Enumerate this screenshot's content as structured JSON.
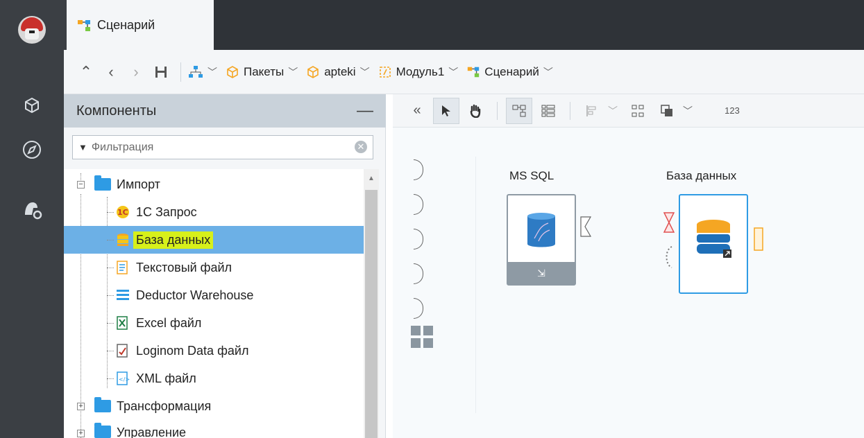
{
  "tab": {
    "label": "Сценарий"
  },
  "breadcrumb": {
    "items": [
      {
        "label": "Пакеты"
      },
      {
        "label": "apteki"
      },
      {
        "label": "Модуль1"
      },
      {
        "label": "Сценарий"
      }
    ]
  },
  "panel": {
    "title": "Компоненты",
    "filter_placeholder": "Фильтрация",
    "tree": {
      "import_label": "Импорт",
      "items": [
        {
          "label": "1С Запрос"
        },
        {
          "label": "База данных"
        },
        {
          "label": "Текстовый файл"
        },
        {
          "label": "Deductor Warehouse"
        },
        {
          "label": "Excel файл"
        },
        {
          "label": "Loginom Data файл"
        },
        {
          "label": "XML файл"
        }
      ],
      "transform_label": "Трансформация",
      "control_label": "Управление"
    }
  },
  "canvas": {
    "nodes": [
      {
        "title": "MS SQL"
      },
      {
        "title": "База данных"
      }
    ]
  },
  "toolbar": {
    "sort_label": "123"
  }
}
